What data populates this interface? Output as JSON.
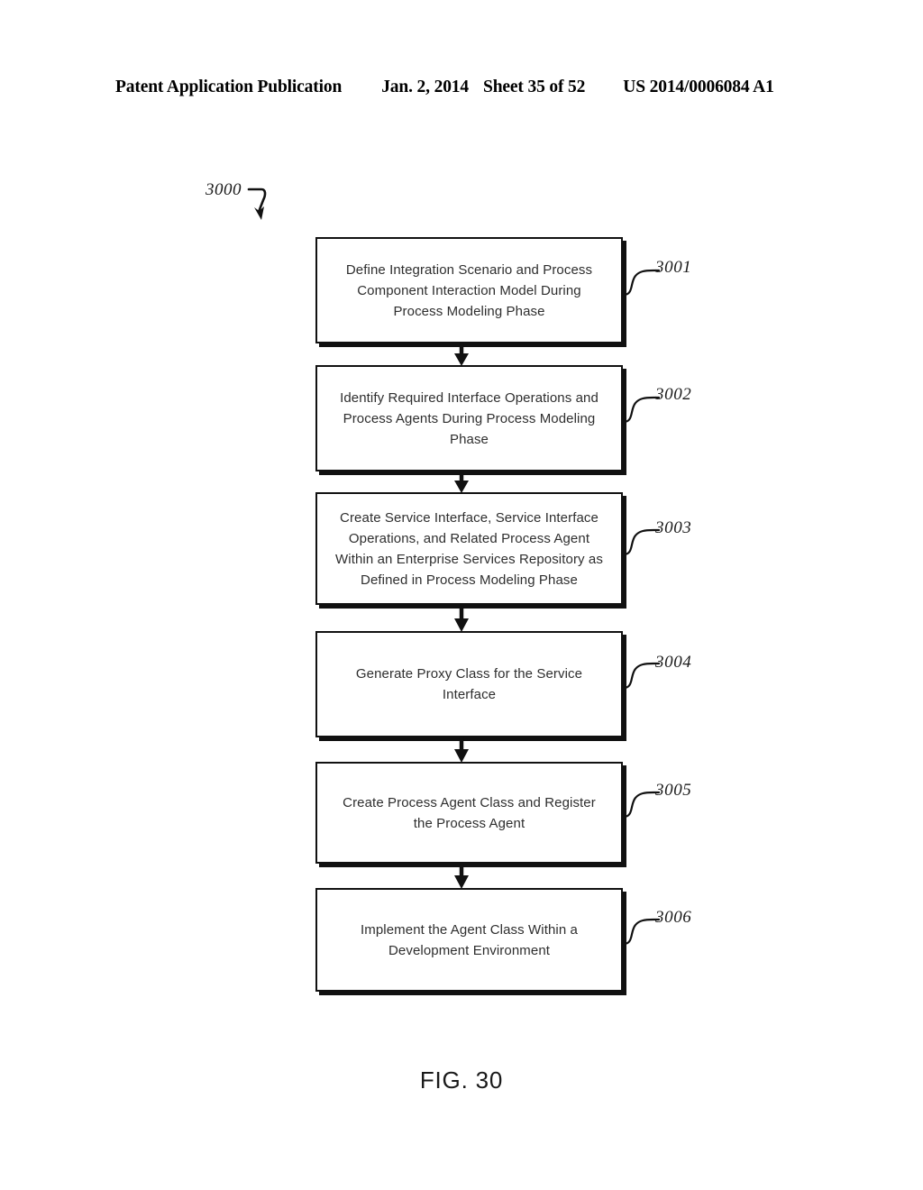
{
  "header": {
    "publication": "Patent Application Publication",
    "date": "Jan. 2, 2014",
    "sheet": "Sheet 35 of 52",
    "doc_number": "US 2014/0006084 A1"
  },
  "figure": {
    "caption": "FIG. 30",
    "diagram_ref": "3000"
  },
  "flowchart": {
    "type": "flowchart",
    "orientation": "vertical",
    "steps": [
      {
        "ref": "3001",
        "text": "Define Integration Scenario and Process Component Interaction Model During Process Modeling Phase"
      },
      {
        "ref": "3002",
        "text": "Identify Required Interface Operations and Process Agents During Process Modeling Phase"
      },
      {
        "ref": "3003",
        "text": "Create Service Interface, Service Interface Operations, and Related Process Agent Within an Enterprise Services Repository as Defined in Process Modeling Phase"
      },
      {
        "ref": "3004",
        "text": "Generate Proxy Class for the Service Interface"
      },
      {
        "ref": "3005",
        "text": "Create Process Agent Class and Register the Process Agent"
      },
      {
        "ref": "3006",
        "text": "Implement the Agent Class Within a Development Environment"
      }
    ]
  },
  "colors": {
    "ink": "#111111",
    "text": "#2e2e2e",
    "page": "#ffffff"
  }
}
